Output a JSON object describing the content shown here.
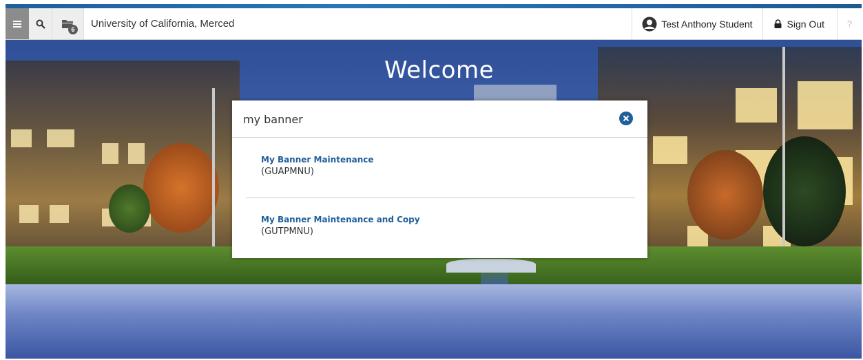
{
  "header": {
    "recent_count": "6",
    "org_name": "University of California, Merced",
    "user_name": "Test Anthony Student",
    "signout_label": "Sign Out",
    "help_label": "?"
  },
  "page": {
    "welcome": "Welcome"
  },
  "search": {
    "query": "my banner",
    "results": [
      {
        "title": "My Banner Maintenance",
        "code": "(GUAPMNU)"
      },
      {
        "title": "My Banner Maintenance and Copy",
        "code": "(GUTPMNU)"
      }
    ]
  },
  "colors": {
    "accent": "#1f5f9a",
    "menu_button": "#8c8c8c"
  },
  "icons": {
    "menu": "hamburger-menu-icon",
    "search": "search-icon",
    "recent": "recent-items-icon",
    "user": "user-avatar-icon",
    "lock": "lock-icon",
    "clear": "clear-search-icon"
  }
}
